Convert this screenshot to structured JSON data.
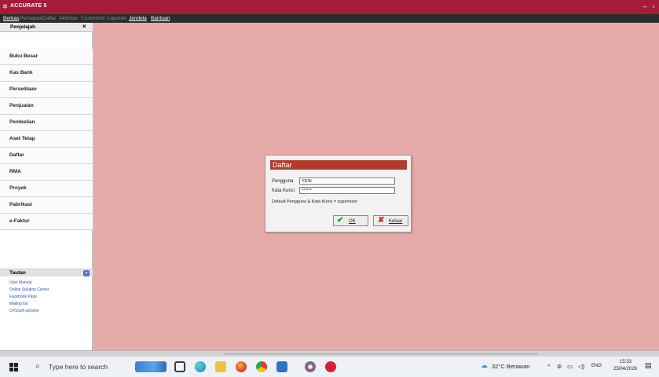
{
  "window": {
    "title": "ACCURATE 5"
  },
  "menu": [
    {
      "label": "Berkas",
      "enabled": true
    },
    {
      "label": "Persiapan",
      "enabled": false
    },
    {
      "label": "Daftar",
      "enabled": false
    },
    {
      "label": "Aktivitas",
      "enabled": false
    },
    {
      "label": "Customize",
      "enabled": false
    },
    {
      "label": "Laporan",
      "enabled": false
    },
    {
      "label": "Jendela",
      "enabled": true
    },
    {
      "label": "Bantuan",
      "enabled": true
    }
  ],
  "sidebar": {
    "title": "Penjelajah",
    "close": "×",
    "items": [
      "Buku Besar",
      "Kas Bank",
      "Persediaan",
      "Penjualan",
      "Pembelian",
      "Aset Tetap",
      "Daftar",
      "RMA",
      "Proyek",
      "Pabrikasi",
      "e-Faktur"
    ],
    "tautan": {
      "title": "Tautan",
      "links": [
        "User Manual",
        "Online Solution Center",
        "Facebook Page",
        "Mailing list",
        "CPSSoft website"
      ]
    }
  },
  "dialog": {
    "title": "Daftar",
    "user_label": "Pengguna",
    "user_value": "YENI",
    "password_label": "Kata Kunci",
    "password_value": "******",
    "hint": "Default Pengguna & Kata Kunci = supervisor",
    "ok_label": "OK",
    "exit_label": "Keluar"
  },
  "taskbar": {
    "search_placeholder": "Type here to search",
    "weather": "32°C Berawan",
    "language": "ENG",
    "time": "15:33",
    "date": "25/04/2026"
  },
  "colors": {
    "titlebar": "#a51b3a",
    "menubar": "#2c2c2c",
    "workspace": "#e6aba9",
    "dialog_title": "#b33a2a"
  },
  "icons": [
    "windows-start-icon",
    "search-icon",
    "task-view-icon",
    "edge-icon",
    "file-explorer-icon",
    "firefox-icon",
    "chrome-icon",
    "mail-icon",
    "photos-icon",
    "accurate-icon",
    "weather-icon",
    "network-icon",
    "volume-icon",
    "notification-icon"
  ]
}
